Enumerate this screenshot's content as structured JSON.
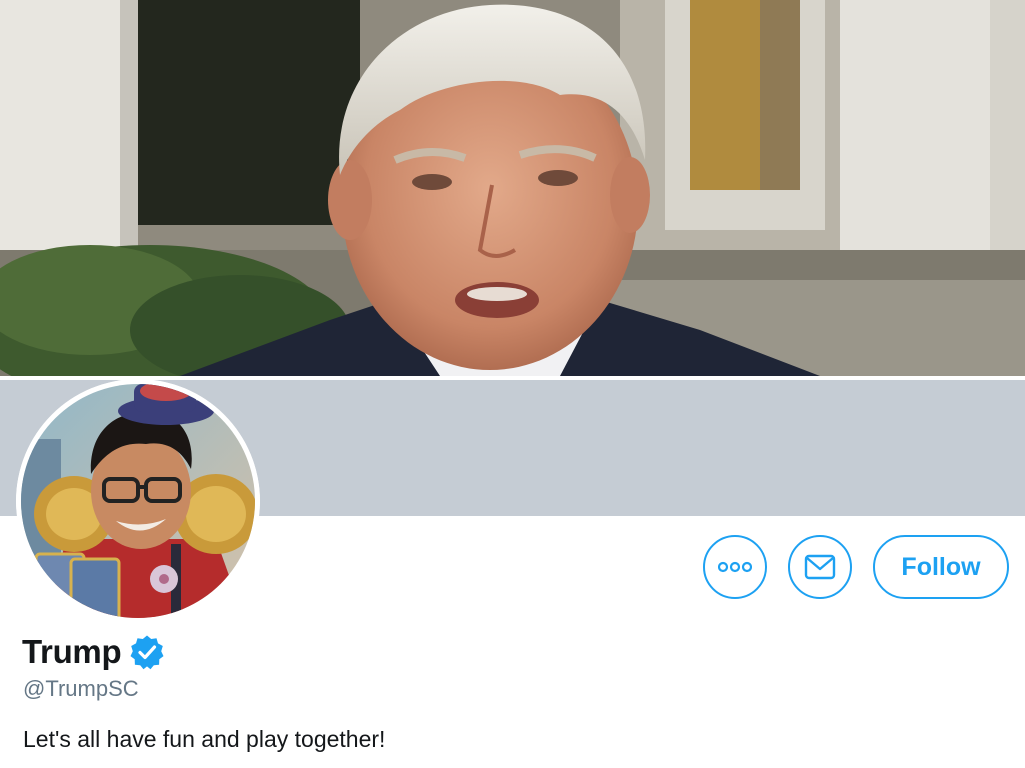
{
  "profile": {
    "display_name": "Trump",
    "handle": "@TrumpSC",
    "bio": "Let's all have fun and play together!",
    "verified": true
  },
  "actions": {
    "more_icon": "more-icon",
    "message_icon": "envelope-icon",
    "follow_label": "Follow"
  },
  "colors": {
    "accent": "#1da1f2",
    "banner": "#c5ccd4",
    "text_primary": "#14171a",
    "text_secondary": "#657786"
  }
}
